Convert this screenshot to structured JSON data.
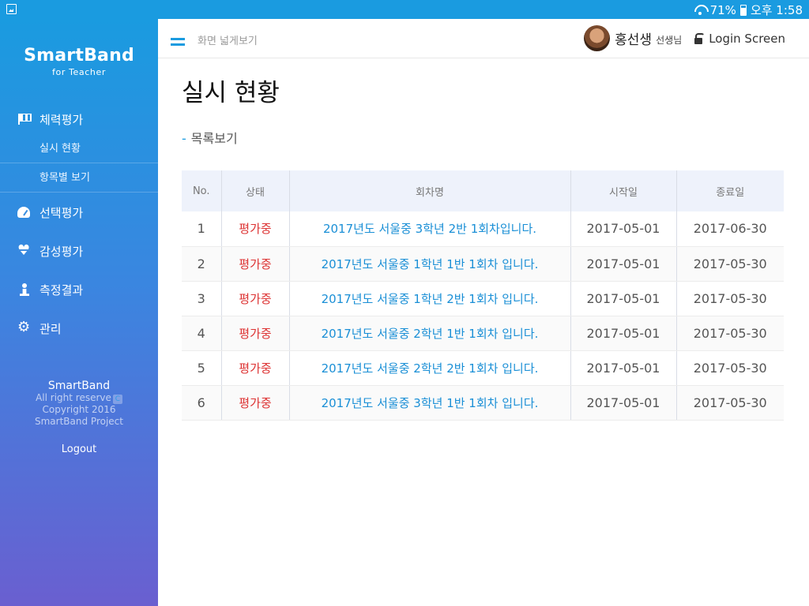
{
  "status_bar": {
    "battery": "71%",
    "time": "오후 1:58"
  },
  "sidebar": {
    "brand_name": "SmartBand",
    "brand_sub": "for Teacher",
    "nav": [
      {
        "label": "체력평가",
        "icon": "flag-icon",
        "children": [
          {
            "label": "실시 현황"
          },
          {
            "label": "항목별 보기"
          }
        ]
      },
      {
        "label": "선택평가",
        "icon": "gauge-icon"
      },
      {
        "label": "감성평가",
        "icon": "heartbeat-icon"
      },
      {
        "label": "측정결과",
        "icon": "person-icon"
      },
      {
        "label": "관리",
        "icon": "gear-icon"
      }
    ],
    "footer": {
      "brand": "SmartBand",
      "rights": "All right reserve",
      "copyright": "Copyright 2016",
      "project": "SmartBand Project",
      "c_glyph": "C"
    },
    "logout": "Logout"
  },
  "header": {
    "wide_view": "화면 넓게보기",
    "user_name": "홍선생",
    "user_title": "선생님",
    "login_label": "Login Screen"
  },
  "main": {
    "title": "실시 현황",
    "list_dash": "-",
    "list_link": "목록보기",
    "table": {
      "columns": [
        "No.",
        "상태",
        "회차명",
        "시작일",
        "종료일"
      ],
      "rows": [
        {
          "no": "1",
          "status": "평가중",
          "title": "2017년도 서울중 3학년 2반 1회차입니다.",
          "start": "2017-05-01",
          "end": "2017-06-30"
        },
        {
          "no": "2",
          "status": "평가중",
          "title": "2017년도 서울중 1학년 1반 1회차 입니다.",
          "start": "2017-05-01",
          "end": "2017-05-30"
        },
        {
          "no": "3",
          "status": "평가중",
          "title": "2017년도 서울중 1학년 2반 1회차 입니다.",
          "start": "2017-05-01",
          "end": "2017-05-30"
        },
        {
          "no": "4",
          "status": "평가중",
          "title": "2017년도 서울중 2학년 1반 1회차 입니다.",
          "start": "2017-05-01",
          "end": "2017-05-30"
        },
        {
          "no": "5",
          "status": "평가중",
          "title": "2017년도 서울중 2학년 2반 1회차 입니다.",
          "start": "2017-05-01",
          "end": "2017-05-30"
        },
        {
          "no": "6",
          "status": "평가중",
          "title": "2017년도 서울중 3학년 1반 1회차 입니다.",
          "start": "2017-05-01",
          "end": "2017-05-30"
        }
      ]
    }
  },
  "colors": {
    "accent": "#1a9be0",
    "status_red": "#d33333",
    "link_blue": "#1a8fd6",
    "sidebar_bottom": "#6a5fd0"
  }
}
